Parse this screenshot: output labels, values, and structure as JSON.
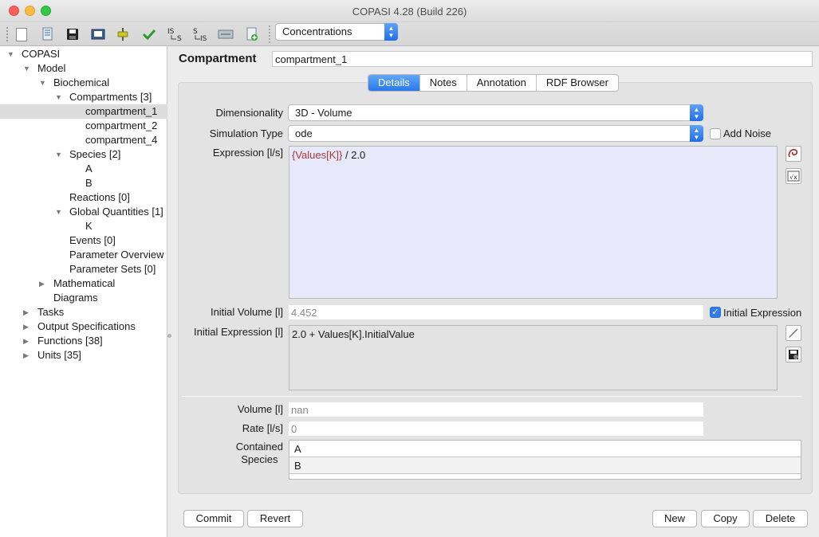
{
  "window": {
    "title": "COPASI 4.28 (Build 226)"
  },
  "toolbar": {
    "buttons": [
      "new-icon",
      "open-icon",
      "save-icon",
      "save-as-image-icon",
      "slider-icon",
      "check-icon",
      "is-to-s-icon",
      "s-to-is-icon",
      "export-icon",
      "add-icon"
    ],
    "mode_select": "Concentrations"
  },
  "tree": {
    "items": [
      {
        "label": "COPASI",
        "expanded": true
      },
      {
        "label": "Model",
        "expanded": true
      },
      {
        "label": "Biochemical",
        "expanded": true
      },
      {
        "label": "Compartments [3]",
        "expanded": true
      },
      {
        "label": "compartment_1",
        "selected": true
      },
      {
        "label": "compartment_2"
      },
      {
        "label": "compartment_4"
      },
      {
        "label": "Species [2]",
        "expanded": true
      },
      {
        "label": "A"
      },
      {
        "label": "B"
      },
      {
        "label": "Reactions [0]"
      },
      {
        "label": "Global Quantities [1]",
        "expanded": true
      },
      {
        "label": "K"
      },
      {
        "label": "Events [0]"
      },
      {
        "label": "Parameter Overview"
      },
      {
        "label": "Parameter Sets [0]"
      },
      {
        "label": "Mathematical",
        "expanded": false
      },
      {
        "label": "Diagrams"
      },
      {
        "label": "Tasks",
        "expanded": false
      },
      {
        "label": "Output Specifications",
        "expanded": false
      },
      {
        "label": "Functions [38]",
        "expanded": false
      },
      {
        "label": "Units [35]",
        "expanded": false
      }
    ]
  },
  "header": {
    "title": "Compartment",
    "name_value": "compartment_1"
  },
  "tabs": [
    "Details",
    "Notes",
    "Annotation",
    "RDF Browser"
  ],
  "details": {
    "dimensionality_label": "Dimensionality",
    "dimensionality_value": "3D - Volume",
    "simulation_type_label": "Simulation Type",
    "simulation_type_value": "ode",
    "add_noise_label": "Add Noise",
    "expression_label": "Expression [l/s]",
    "expression_ref": "{Values[K]}",
    "expression_rest": " / 2.0",
    "initial_volume_label": "Initial Volume [l]",
    "initial_volume_value": "4.452",
    "initial_expression_checkbox_label": "Initial Expression",
    "initial_expression_label": "Initial Expression [l]",
    "initial_expression_value": "2.0 + Values[K].InitialValue",
    "volume_label": "Volume [l]",
    "volume_value": "nan",
    "rate_label": "Rate [l/s]",
    "rate_value": "0",
    "contained_species_label_1": "Contained",
    "contained_species_label_2": "Species",
    "contained_species": [
      "A",
      "B"
    ]
  },
  "buttons": {
    "commit": "Commit",
    "revert": "Revert",
    "new": "New",
    "copy": "Copy",
    "delete": "Delete"
  },
  "colors": {
    "accent": "#2a78ea",
    "expression_ref": "#a33a3a",
    "expression_bg": "#e8e8fb"
  }
}
